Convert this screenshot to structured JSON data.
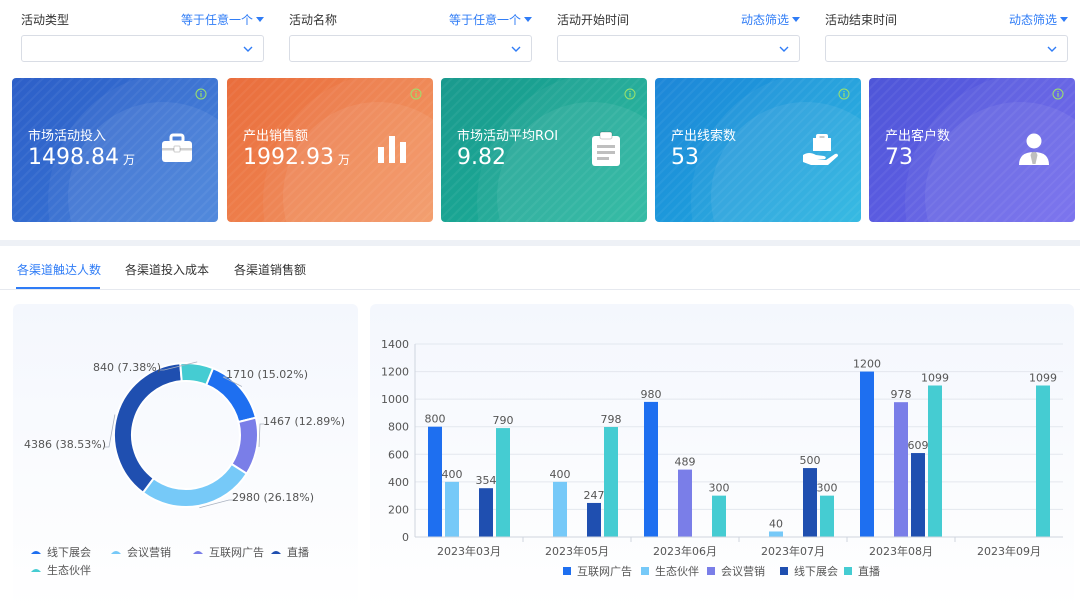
{
  "filters": [
    {
      "label": "活动类型",
      "operator": "等于任意一个",
      "value": ""
    },
    {
      "label": "活动名称",
      "operator": "等于任意一个",
      "value": ""
    },
    {
      "label": "活动开始时间",
      "operator": "动态筛选",
      "value": ""
    },
    {
      "label": "活动结束时间",
      "operator": "动态筛选",
      "value": ""
    }
  ],
  "kpis": [
    {
      "label": "市场活动投入",
      "value": "1498.84",
      "unit": "万",
      "icon": "briefcase-icon",
      "from": "#2d5fc8",
      "to": "#3a7ad8"
    },
    {
      "label": "产出销售额",
      "value": "1992.93",
      "unit": "万",
      "icon": "bar-chart-icon",
      "from": "#e96d3c",
      "to": "#f3935d"
    },
    {
      "label": "市场活动平均ROI",
      "value": "9.82",
      "unit": "",
      "icon": "clipboard-icon",
      "from": "#1a9a8e",
      "to": "#1bb39a"
    },
    {
      "label": "产出线索数",
      "value": "53",
      "unit": "",
      "icon": "hand-bag-icon",
      "from": "#1e86d8",
      "to": "#1cb1df"
    },
    {
      "label": "产出客户数",
      "value": "73",
      "unit": "",
      "icon": "user-icon",
      "from": "#4e56d8",
      "to": "#6c63ec"
    }
  ],
  "tabs": [
    "各渠道触达人数",
    "各渠道投入成本",
    "各渠道销售额"
  ],
  "active_tab": 0,
  "colors": {
    "互联网广告": "#1e6ff0",
    "生态伙伴": "#76c9f8",
    "会议营销": "#7a7ee8",
    "线下展会": "#1f4fb0",
    "直播": "#45ccd2"
  },
  "chart_data": [
    {
      "type": "pie",
      "donut": true,
      "slices": [
        {
          "name": "互联网广告",
          "value": 1710,
          "label": "1710 (15.02%)"
        },
        {
          "name": "会议营销",
          "value": 1467,
          "label": "1467 (12.89%)"
        },
        {
          "name": "生态伙伴",
          "value": 2980,
          "label": "2980 (26.18%)"
        },
        {
          "name": "线下展会",
          "value": 4386,
          "label": "4386 (38.53%)"
        },
        {
          "name": "直播",
          "value": 840,
          "label": "840 (7.38%)"
        }
      ],
      "legend": [
        "线下展会",
        "会议营销",
        "互联网广告",
        "直播",
        "生态伙伴"
      ],
      "legend_colors": [
        "#1e6ff0",
        "#76c9f8",
        "#7a7ee8",
        "#1f4fb0",
        "#45ccd2"
      ],
      "legend_position": "bottom-left"
    },
    {
      "type": "bar",
      "categories": [
        "2023年03月",
        "2023年05月",
        "2023年06月",
        "2023年07月",
        "2023年08月",
        "2023年09月"
      ],
      "series": [
        {
          "name": "互联网广告",
          "values": [
            800,
            null,
            980,
            null,
            1200,
            null
          ]
        },
        {
          "name": "生态伙伴",
          "values": [
            400,
            400,
            null,
            40,
            null,
            null
          ]
        },
        {
          "name": "会议营销",
          "values": [
            null,
            null,
            489,
            null,
            978,
            null
          ]
        },
        {
          "name": "线下展会",
          "values": [
            354,
            247,
            null,
            500,
            609,
            null
          ]
        },
        {
          "name": "直播",
          "values": [
            790,
            798,
            300,
            300,
            1099,
            1099
          ]
        }
      ],
      "ylim": [
        0,
        1400
      ],
      "yticks": [
        0,
        200,
        400,
        600,
        800,
        1000,
        1200,
        1400
      ],
      "grid": true,
      "legend_position": "bottom"
    }
  ]
}
